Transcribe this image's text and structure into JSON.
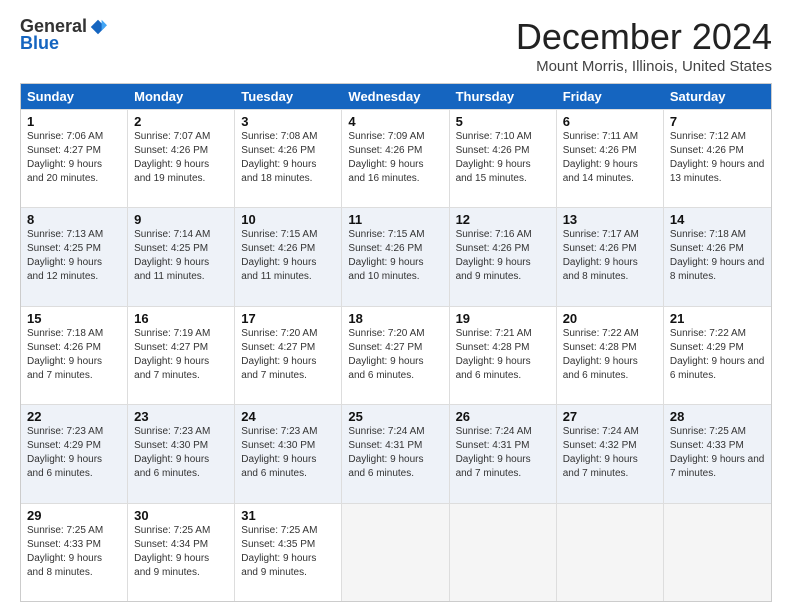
{
  "logo": {
    "general": "General",
    "blue": "Blue"
  },
  "title": "December 2024",
  "subtitle": "Mount Morris, Illinois, United States",
  "days_of_week": [
    "Sunday",
    "Monday",
    "Tuesday",
    "Wednesday",
    "Thursday",
    "Friday",
    "Saturday"
  ],
  "weeks": [
    [
      {
        "day": "1",
        "sunrise": "7:06 AM",
        "sunset": "4:27 PM",
        "daylight": "9 hours and 20 minutes."
      },
      {
        "day": "2",
        "sunrise": "7:07 AM",
        "sunset": "4:26 PM",
        "daylight": "9 hours and 19 minutes."
      },
      {
        "day": "3",
        "sunrise": "7:08 AM",
        "sunset": "4:26 PM",
        "daylight": "9 hours and 18 minutes."
      },
      {
        "day": "4",
        "sunrise": "7:09 AM",
        "sunset": "4:26 PM",
        "daylight": "9 hours and 16 minutes."
      },
      {
        "day": "5",
        "sunrise": "7:10 AM",
        "sunset": "4:26 PM",
        "daylight": "9 hours and 15 minutes."
      },
      {
        "day": "6",
        "sunrise": "7:11 AM",
        "sunset": "4:26 PM",
        "daylight": "9 hours and 14 minutes."
      },
      {
        "day": "7",
        "sunrise": "7:12 AM",
        "sunset": "4:26 PM",
        "daylight": "9 hours and 13 minutes."
      }
    ],
    [
      {
        "day": "8",
        "sunrise": "7:13 AM",
        "sunset": "4:25 PM",
        "daylight": "9 hours and 12 minutes."
      },
      {
        "day": "9",
        "sunrise": "7:14 AM",
        "sunset": "4:25 PM",
        "daylight": "9 hours and 11 minutes."
      },
      {
        "day": "10",
        "sunrise": "7:15 AM",
        "sunset": "4:26 PM",
        "daylight": "9 hours and 11 minutes."
      },
      {
        "day": "11",
        "sunrise": "7:15 AM",
        "sunset": "4:26 PM",
        "daylight": "9 hours and 10 minutes."
      },
      {
        "day": "12",
        "sunrise": "7:16 AM",
        "sunset": "4:26 PM",
        "daylight": "9 hours and 9 minutes."
      },
      {
        "day": "13",
        "sunrise": "7:17 AM",
        "sunset": "4:26 PM",
        "daylight": "9 hours and 8 minutes."
      },
      {
        "day": "14",
        "sunrise": "7:18 AM",
        "sunset": "4:26 PM",
        "daylight": "9 hours and 8 minutes."
      }
    ],
    [
      {
        "day": "15",
        "sunrise": "7:18 AM",
        "sunset": "4:26 PM",
        "daylight": "9 hours and 7 minutes."
      },
      {
        "day": "16",
        "sunrise": "7:19 AM",
        "sunset": "4:27 PM",
        "daylight": "9 hours and 7 minutes."
      },
      {
        "day": "17",
        "sunrise": "7:20 AM",
        "sunset": "4:27 PM",
        "daylight": "9 hours and 7 minutes."
      },
      {
        "day": "18",
        "sunrise": "7:20 AM",
        "sunset": "4:27 PM",
        "daylight": "9 hours and 6 minutes."
      },
      {
        "day": "19",
        "sunrise": "7:21 AM",
        "sunset": "4:28 PM",
        "daylight": "9 hours and 6 minutes."
      },
      {
        "day": "20",
        "sunrise": "7:22 AM",
        "sunset": "4:28 PM",
        "daylight": "9 hours and 6 minutes."
      },
      {
        "day": "21",
        "sunrise": "7:22 AM",
        "sunset": "4:29 PM",
        "daylight": "9 hours and 6 minutes."
      }
    ],
    [
      {
        "day": "22",
        "sunrise": "7:23 AM",
        "sunset": "4:29 PM",
        "daylight": "9 hours and 6 minutes."
      },
      {
        "day": "23",
        "sunrise": "7:23 AM",
        "sunset": "4:30 PM",
        "daylight": "9 hours and 6 minutes."
      },
      {
        "day": "24",
        "sunrise": "7:23 AM",
        "sunset": "4:30 PM",
        "daylight": "9 hours and 6 minutes."
      },
      {
        "day": "25",
        "sunrise": "7:24 AM",
        "sunset": "4:31 PM",
        "daylight": "9 hours and 6 minutes."
      },
      {
        "day": "26",
        "sunrise": "7:24 AM",
        "sunset": "4:31 PM",
        "daylight": "9 hours and 7 minutes."
      },
      {
        "day": "27",
        "sunrise": "7:24 AM",
        "sunset": "4:32 PM",
        "daylight": "9 hours and 7 minutes."
      },
      {
        "day": "28",
        "sunrise": "7:25 AM",
        "sunset": "4:33 PM",
        "daylight": "9 hours and 7 minutes."
      }
    ],
    [
      {
        "day": "29",
        "sunrise": "7:25 AM",
        "sunset": "4:33 PM",
        "daylight": "9 hours and 8 minutes."
      },
      {
        "day": "30",
        "sunrise": "7:25 AM",
        "sunset": "4:34 PM",
        "daylight": "9 hours and 9 minutes."
      },
      {
        "day": "31",
        "sunrise": "7:25 AM",
        "sunset": "4:35 PM",
        "daylight": "9 hours and 9 minutes."
      },
      null,
      null,
      null,
      null
    ]
  ]
}
